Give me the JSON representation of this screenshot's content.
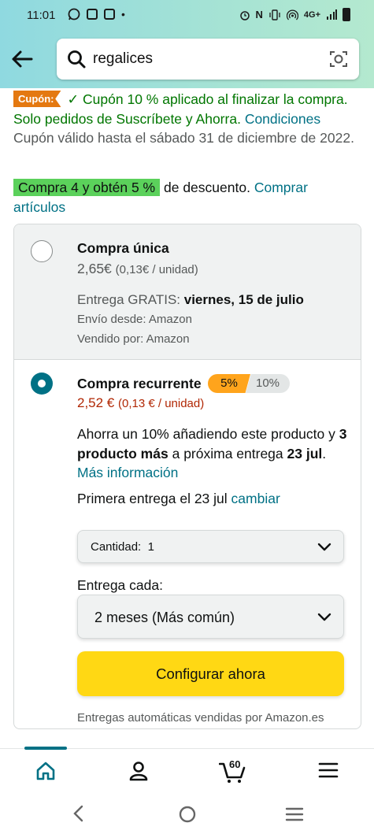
{
  "status_bar": {
    "time": "11:01",
    "network": "4G+"
  },
  "search": {
    "query": "regalices"
  },
  "coupon": {
    "tag": "Cupón:",
    "check": "✓",
    "text": "Cupón 10 % aplicado al finalizar la compra. Solo pedidos de Suscríbete y Ahorra.",
    "conditions_link": "Condiciones",
    "validity": "Cupón válido hasta el sábado 31 de diciembre de 2022."
  },
  "promo": {
    "badge": "Compra 4 y obtén 5 %",
    "text": "de descuento.",
    "link": "Comprar artículos"
  },
  "one_time": {
    "title": "Compra única",
    "price": "2,65€",
    "unit_price": "(0,13€ / unidad)",
    "delivery_prefix": "Entrega GRATIS:",
    "delivery_date": "viernes, 15 de julio",
    "ships_from": "Envío desde: Amazon",
    "sold_by": "Vendido por: Amazon"
  },
  "recurring": {
    "title": "Compra recurrente",
    "tier_current": "5%",
    "tier_next": "10%",
    "price": "2,52 €",
    "unit_price": "(0,13 € / unidad)",
    "saving_1": "Ahorra un 10% añadiendo este producto y",
    "saving_bold": "3 producto más",
    "saving_2": "a próxima entrega",
    "saving_date": "23 jul",
    "more_info": "Más información",
    "first_delivery": "Primera entrega el 23 jul",
    "change_link": "cambiar",
    "quantity_label": "Cantidad:",
    "quantity_value": "1",
    "every_label": "Entrega cada:",
    "every_value": "2 meses (Más común)",
    "cta": "Configurar ahora",
    "footer": "Entregas automáticas vendidas por Amazon.es"
  },
  "bottom_nav": {
    "cart_count": "60"
  },
  "colors": {
    "accent": "#007185",
    "cta": "#ffd814",
    "price_red": "#b12704",
    "coupon_green": "#007600",
    "tag_orange": "#e47911"
  }
}
